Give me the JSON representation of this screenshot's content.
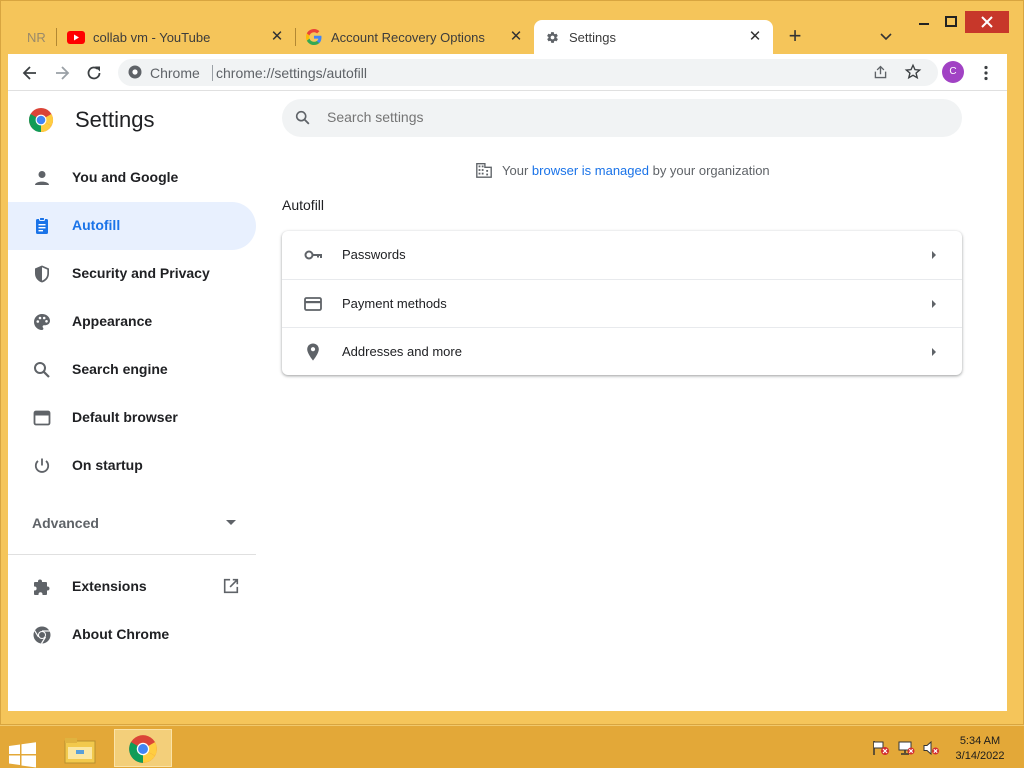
{
  "browser": {
    "tabs": [
      {
        "label": "NR"
      },
      {
        "label": "collab vm - YouTube"
      },
      {
        "label": "Account Recovery Options"
      },
      {
        "label": "Settings"
      }
    ],
    "omnibox": {
      "scheme_label": "Chrome",
      "url": "chrome://settings/autofill"
    },
    "profile_initial": "C"
  },
  "settings": {
    "title": "Settings",
    "search_placeholder": "Search settings",
    "sidebar": [
      {
        "label": "You and Google",
        "icon": "person-icon"
      },
      {
        "label": "Autofill",
        "icon": "clipboard-icon",
        "selected": true
      },
      {
        "label": "Security and Privacy",
        "icon": "shield-icon"
      },
      {
        "label": "Appearance",
        "icon": "palette-icon"
      },
      {
        "label": "Search engine",
        "icon": "search-icon"
      },
      {
        "label": "Default browser",
        "icon": "browser-window-icon"
      },
      {
        "label": "On startup",
        "icon": "power-icon"
      }
    ],
    "advanced_label": "Advanced",
    "extensions_label": "Extensions",
    "about_label": "About Chrome",
    "managed": {
      "prefix": "Your",
      "link": "browser is managed",
      "suffix": "by your organization"
    },
    "section_title": "Autofill",
    "autofill_items": [
      {
        "label": "Passwords",
        "icon": "key-icon"
      },
      {
        "label": "Payment methods",
        "icon": "credit-card-icon"
      },
      {
        "label": "Addresses and more",
        "icon": "location-pin-icon"
      }
    ]
  },
  "taskbar": {
    "time": "5:34 AM",
    "date": "3/14/2022"
  },
  "colors": {
    "accent": "#1a73e8",
    "selected_bg": "#e8f0fe",
    "frame": "#f5c55a",
    "taskbar": "#e3a838",
    "avatar": "#a142c4",
    "close": "#c7372a"
  }
}
